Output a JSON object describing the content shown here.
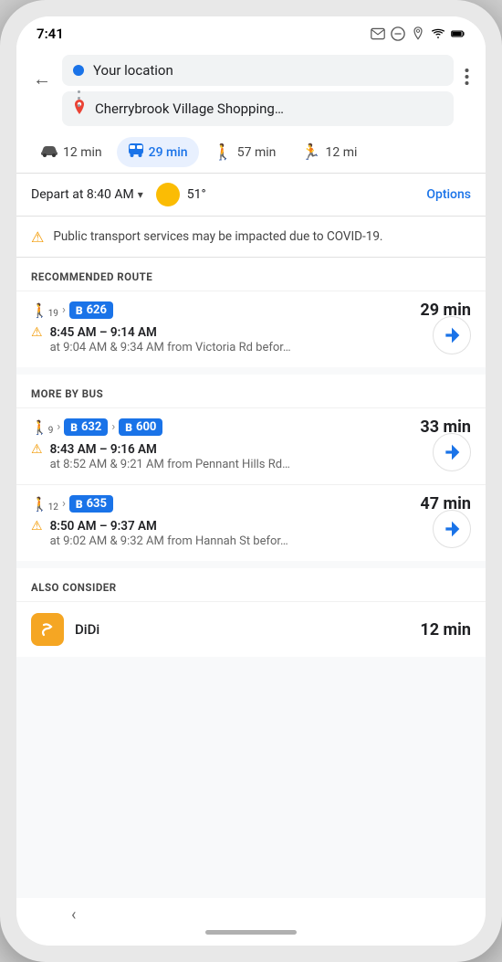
{
  "status_bar": {
    "time": "7:41"
  },
  "header": {
    "back_label": "←",
    "location_placeholder": "Your location",
    "destination_text": "Cherrybrook Village Shopping…",
    "more_icon": "⋮"
  },
  "mode_tabs": [
    {
      "id": "car",
      "icon": "🚗",
      "label": "12 min",
      "active": false
    },
    {
      "id": "bus",
      "icon": "🚌",
      "label": "29 min",
      "active": true
    },
    {
      "id": "walk",
      "icon": "🚶",
      "label": "57 min",
      "active": false
    },
    {
      "id": "ride",
      "icon": "🏃",
      "label": "12 mi",
      "active": false
    }
  ],
  "depart": {
    "label": "Depart at 8:40 AM",
    "temperature": "51°",
    "options_label": "Options"
  },
  "covid": {
    "notice": "Public transport services may be impacted due to COVID-19."
  },
  "recommended_route": {
    "header": "RECOMMENDED ROUTE",
    "walk_sub": "19",
    "bus_number": "626",
    "duration": "29 min",
    "times": "8:45 AM – 9:14 AM",
    "from": "at 9:04 AM & 9:34 AM from Victoria Rd befor…"
  },
  "more_by_bus": {
    "header": "MORE BY BUS",
    "routes": [
      {
        "walk_sub": "9",
        "buses": [
          "632",
          "600"
        ],
        "duration": "33 min",
        "times": "8:43 AM – 9:16 AM",
        "from": "at 8:52 AM & 9:21 AM from Pennant Hills Rd…"
      },
      {
        "walk_sub": "12",
        "buses": [
          "635"
        ],
        "duration": "47 min",
        "times": "8:50 AM – 9:37 AM",
        "from": "at 9:02 AM & 9:32 AM from Hannah St befor…"
      }
    ]
  },
  "also_consider": {
    "header": "ALSO CONSIDER",
    "didi_label": "DiDi",
    "didi_time": "12 min"
  }
}
